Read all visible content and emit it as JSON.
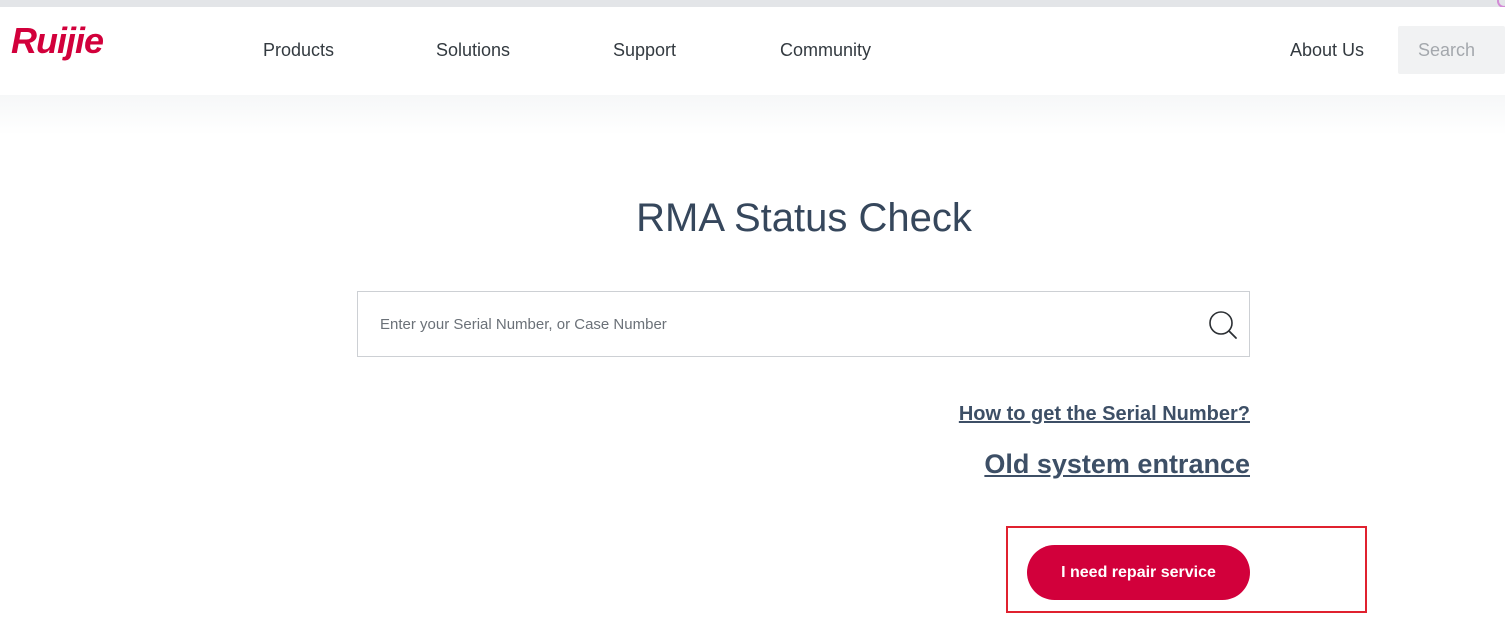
{
  "brand": {
    "logo_text": "Ruijie",
    "color": "#d2003b"
  },
  "nav": {
    "items": [
      {
        "label": "Products"
      },
      {
        "label": "Solutions"
      },
      {
        "label": "Support"
      },
      {
        "label": "Community"
      }
    ],
    "about": "About Us",
    "search_placeholder": "Search"
  },
  "main": {
    "title": "RMA Status Check",
    "serial_input": {
      "value": "",
      "placeholder": "Enter your Serial Number, or Case Number",
      "icon": "search-icon"
    },
    "links": {
      "serial_help": "How to get the Serial Number?",
      "old_system": "Old system entrance"
    },
    "repair_button": "I need repair service"
  },
  "colors": {
    "title_text": "#36475c",
    "link_text": "#3d4f66",
    "button_bg": "#d2003b",
    "highlight_border": "#e0212f"
  }
}
